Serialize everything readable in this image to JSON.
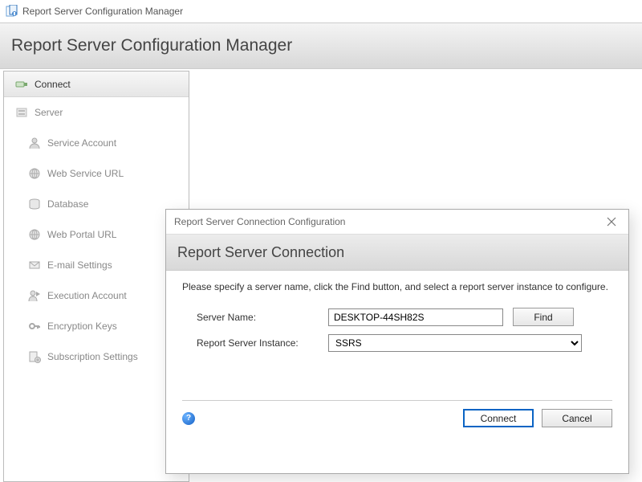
{
  "titlebar": {
    "title": "Report Server Configuration Manager"
  },
  "header": {
    "title": "Report Server Configuration Manager"
  },
  "sidebar": {
    "items": [
      {
        "label": "Connect"
      },
      {
        "label": "Server"
      },
      {
        "label": "Service Account"
      },
      {
        "label": "Web Service URL"
      },
      {
        "label": "Database"
      },
      {
        "label": "Web Portal URL"
      },
      {
        "label": "E-mail Settings"
      },
      {
        "label": "Execution Account"
      },
      {
        "label": "Encryption Keys"
      },
      {
        "label": "Subscription Settings"
      }
    ]
  },
  "dialog": {
    "title": "Report Server Connection Configuration",
    "heading": "Report Server Connection",
    "instruction": "Please specify a server name, click the Find button, and select a report server instance to configure.",
    "server_name_label": "Server Name:",
    "server_name_value": "DESKTOP-44SH82S",
    "find_label": "Find",
    "instance_label": "Report Server Instance:",
    "instance_value": "SSRS",
    "connect_label": "Connect",
    "cancel_label": "Cancel"
  }
}
